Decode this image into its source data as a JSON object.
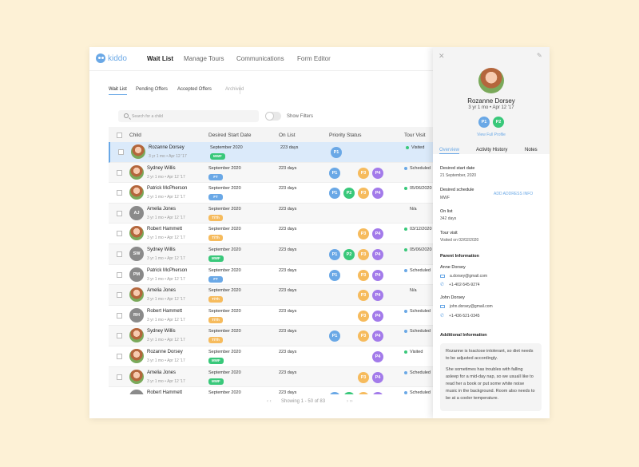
{
  "app": {
    "logo": "kiddo"
  },
  "nav": {
    "items": [
      "Wait List",
      "Manage Tours",
      "Communications",
      "Form Editor"
    ],
    "active": 0
  },
  "subtabs": {
    "items": [
      "Wait List",
      "Pending Offers",
      "Accepted Offers",
      "Archived"
    ],
    "active": 0
  },
  "search": {
    "placeholder": "Search for a child"
  },
  "filters": {
    "label": "Show Filters"
  },
  "table": {
    "headers": [
      "Child",
      "Desired Start Date",
      "On List",
      "Priority Status",
      "Tour Visit"
    ],
    "rows": [
      {
        "name": "Rozanne Dorsey",
        "age": "3 yr 1 mo • Apr 12 '17",
        "avatar": "photo",
        "start": "September 2020",
        "schedule": "MWF",
        "on_list": "223 days",
        "priority": [
          "P1"
        ],
        "tour": "Visited",
        "tour_color": "#39c87a",
        "selected": true
      },
      {
        "name": "Sydney Willis",
        "age": "3 yr 1 mo • Apr 12 '17",
        "avatar": "photo",
        "start": "September 2020",
        "schedule": "FT",
        "on_list": "223 days",
        "priority": [
          "P1",
          "P3",
          "P4"
        ],
        "tour": "Scheduled",
        "tour_color": "#6aa8e6"
      },
      {
        "name": "Patrick McPherson",
        "age": "3 yr 1 mo • Apr 12 '17",
        "avatar": "photo",
        "start": "September 2020",
        "schedule": "FT",
        "on_list": "223 days",
        "priority": [
          "P1",
          "P2",
          "P3",
          "P4"
        ],
        "tour": "05/06/2020",
        "tour_color": "#39c87a"
      },
      {
        "name": "Amelia Jones",
        "age": "3 yr 1 mo • Apr 12 '17",
        "avatar": "AJ",
        "start": "September 2020",
        "schedule": "T/Th",
        "on_list": "223 days",
        "priority": [],
        "tour": "N/a",
        "tour_color": ""
      },
      {
        "name": "Robert Hammett",
        "age": "3 yr 1 mo • Apr 12 '17",
        "avatar": "photo",
        "start": "September 2020",
        "schedule": "T/Th",
        "on_list": "223 days",
        "priority": [
          "P3",
          "P4"
        ],
        "tour": "03/12/2020",
        "tour_color": "#39c87a"
      },
      {
        "name": "Sydney Willis",
        "age": "3 yr 1 mo • Apr 12 '17",
        "avatar": "SW",
        "start": "September 2020",
        "schedule": "MWF",
        "on_list": "223 days",
        "priority": [
          "P1",
          "P2",
          "P3",
          "P4"
        ],
        "tour": "05/06/2020",
        "tour_color": "#39c87a"
      },
      {
        "name": "Patrick McPherson",
        "age": "3 yr 1 mo • Apr 12 '17",
        "avatar": "PM",
        "start": "September 2020",
        "schedule": "FT",
        "on_list": "223 days",
        "priority": [
          "P1",
          "P3",
          "P4"
        ],
        "tour": "Scheduled",
        "tour_color": "#6aa8e6"
      },
      {
        "name": "Amelia Jones",
        "age": "3 yr 1 mo • Apr 12 '17",
        "avatar": "photo",
        "start": "September 2020",
        "schedule": "T/Th",
        "on_list": "223 days",
        "priority": [
          "P3",
          "P4"
        ],
        "tour": "N/a",
        "tour_color": ""
      },
      {
        "name": "Robert Hammett",
        "age": "3 yr 1 mo • Apr 12 '17",
        "avatar": "RH",
        "start": "September 2020",
        "schedule": "T/Th",
        "on_list": "223 days",
        "priority": [
          "P3",
          "P4"
        ],
        "tour": "Scheduled",
        "tour_color": "#6aa8e6"
      },
      {
        "name": "Sydney Willis",
        "age": "3 yr 1 mo • Apr 12 '17",
        "avatar": "photo",
        "start": "September 2020",
        "schedule": "T/Th",
        "on_list": "223 days",
        "priority": [
          "P1",
          "P3",
          "P4"
        ],
        "tour": "Scheduled",
        "tour_color": "#6aa8e6"
      },
      {
        "name": "Rozanne Dorsey",
        "age": "3 yr 1 mo • Apr 12 '17",
        "avatar": "photo",
        "start": "September 2020",
        "schedule": "MWF",
        "on_list": "223 days",
        "priority": [
          "P4"
        ],
        "tour": "Visited",
        "tour_color": "#39c87a"
      },
      {
        "name": "Amelia Jones",
        "age": "3 yr 1 mo • Apr 12 '17",
        "avatar": "photo",
        "start": "September 2020",
        "schedule": "MWF",
        "on_list": "223 days",
        "priority": [
          "P3",
          "P4"
        ],
        "tour": "Scheduled",
        "tour_color": "#6aa8e6"
      },
      {
        "name": "Robert Hammett",
        "age": "3 yr 1 mo • Apr 12 '17",
        "avatar": "RH",
        "start": "September 2020",
        "schedule": "MWF",
        "on_list": "223 days",
        "priority": [
          "P1",
          "P2",
          "P3",
          "P4"
        ],
        "tour": "Scheduled",
        "tour_color": "#6aa8e6"
      }
    ]
  },
  "pager": {
    "text": "Showing 1 - 50 of 83"
  },
  "colors": {
    "MWF": "#39c87a",
    "FT": "#6aa8e6",
    "T/Th": "#f6bb5d",
    "P1": "#6aa8e6",
    "P2": "#39c87a",
    "P3": "#f6bb5d",
    "P4": "#a37bea",
    "accent": "#6aa8e6"
  },
  "profile": {
    "name": "Rozanne Dorsey",
    "age": "3 yr 1 mo • Apr 12 '17",
    "priority": [
      "P1",
      "P2"
    ],
    "view_full": "View Full Profile",
    "tabs": [
      "Overview",
      "Activity History",
      "Notes"
    ],
    "desired_start_label": "Desired start date",
    "desired_start": "21 September, 2020",
    "schedule_label": "Desired schedule",
    "schedule": "MWF",
    "add_info": "ADD ADDRESS INFO",
    "on_list_label": "On list",
    "on_list": "342 days",
    "tour_label": "Tour visit",
    "tour": "Visited on 02/02/2020",
    "parent_label": "Parent Information",
    "parents": [
      {
        "name": "Anne Dorsey",
        "email": "a.dorsey@gmail.com",
        "phone": "+1-402-545-9274"
      },
      {
        "name": "John Dorsey",
        "email": "john.dorsey@gmail.com",
        "phone": "+1-436-521-0345"
      }
    ],
    "additional_label": "Additional Information",
    "additional": [
      "Rozanne is loactose intolerant, so diet needs to be adjusted accordingly.",
      "She sometimes has troubles with falling asleep for a mid-day nap, so we usuall like to read her a book or put some white noise music in the background. Room also needs to be at a cooler temperature."
    ]
  }
}
